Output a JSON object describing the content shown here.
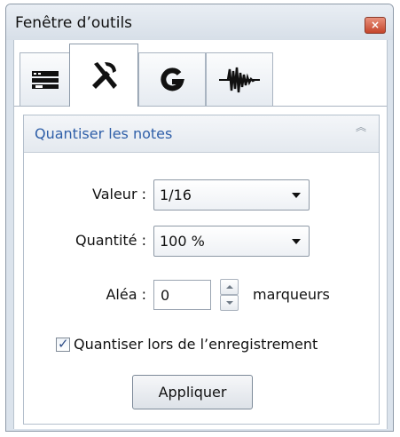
{
  "window": {
    "title": "Fenêtre d’outils",
    "close_icon": "close-icon",
    "close_glyph": "×",
    "close_color": "#c5452b"
  },
  "tabs": [
    {
      "name": "tab-mixer",
      "icon": "mixer-icon",
      "active": false
    },
    {
      "name": "tab-tools",
      "icon": "tools-icon",
      "active": true
    },
    {
      "name": "tab-g",
      "icon": "g-icon",
      "active": false
    },
    {
      "name": "tab-waveform",
      "icon": "waveform-icon",
      "active": false
    }
  ],
  "panel": {
    "title": "Quantiser les notes",
    "collapse_icon": "double-chevron-up-icon",
    "collapse_glyph": "︽",
    "title_color": "#2f5fa8"
  },
  "fields": {
    "valeur_label": "Valeur :",
    "valeur_value": "1/16",
    "quantite_label": "Quantité :",
    "quantite_value": "100 %",
    "alea_label": "Aléa :",
    "alea_value": "0",
    "alea_unit": "marqueurs"
  },
  "checkbox": {
    "label": "Quantiser lors de l’enregistrement",
    "checked": true,
    "check_glyph": "✓"
  },
  "apply_button": {
    "label": "Appliquer"
  }
}
